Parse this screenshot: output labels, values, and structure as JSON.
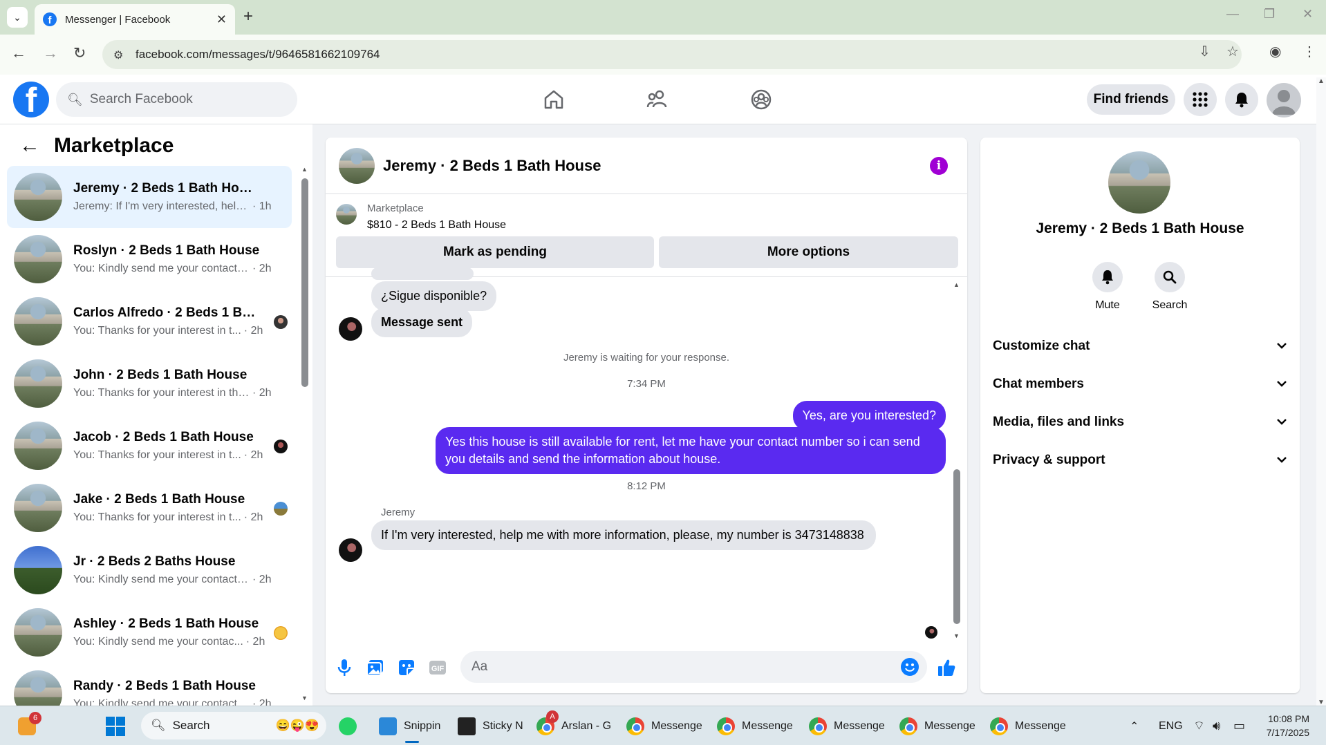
{
  "browser": {
    "tab_title": "Messenger | Facebook",
    "url": "facebook.com/messages/t/9646581662109764"
  },
  "fb": {
    "search_placeholder": "Search Facebook",
    "find_friends": "Find friends"
  },
  "sidebar": {
    "title": "Marketplace",
    "conversations": [
      {
        "name": "Jeremy · 2 Beds 1 Bath House",
        "preview": "Jeremy: If I'm very interested, help ...",
        "time": "· 1h",
        "active": true
      },
      {
        "name": "Roslyn · 2 Beds 1 Bath House",
        "preview": "You: Kindly send me your contact n...",
        "time": "· 2h"
      },
      {
        "name": "Carlos Alfredo · 2 Beds 1 Bath ...",
        "preview": "You: Thanks for your interest in t...",
        "time": "· 2h"
      },
      {
        "name": "John · 2 Beds 1 Bath House",
        "preview": "You: Thanks for your interest in the ...",
        "time": "· 2h"
      },
      {
        "name": "Jacob · 2 Beds 1 Bath House",
        "preview": "You: Thanks for your interest in t...",
        "time": "· 2h"
      },
      {
        "name": "Jake · 2 Beds 1 Bath House",
        "preview": "You: Thanks for your interest in t...",
        "time": "· 2h"
      },
      {
        "name": "Jr · 2 Beds 2 Baths House",
        "preview": "You: Kindly send me your contact n...",
        "time": "· 2h"
      },
      {
        "name": "Ashley · 2 Beds 1 Bath House",
        "preview": "You: Kindly send me your contac...",
        "time": "· 2h"
      },
      {
        "name": "Randy · 2 Beds 1 Bath House",
        "preview": "You: Kindly send me your contact n...",
        "time": "· 2h"
      }
    ]
  },
  "chat": {
    "title": "Jeremy · 2 Beds 1 Bath House",
    "marketplace_label": "Marketplace",
    "listing": "$810 - 2 Beds 1 Bath House",
    "mark_pending": "Mark as pending",
    "more_options": "More options",
    "messages": {
      "m1": "¿Sigue disponible?",
      "m2": "Message sent",
      "waiting": "Jeremy is waiting for your response.",
      "time1": "7:34 PM",
      "m3": "Yes, are you interested?",
      "m4": "Yes this house is still available for rent, let me have your contact number so i can send you details and send the information about house.",
      "time2": "8:12 PM",
      "sender": "Jeremy",
      "m5": "If I'm very interested, help me with more information, please, my number is 3473148838"
    },
    "composer_placeholder": "Aa"
  },
  "details": {
    "name": "Jeremy · 2 Beds 1 Bath House",
    "mute": "Mute",
    "search": "Search",
    "sections": [
      "Customize chat",
      "Chat members",
      "Media, files and links",
      "Privacy & support"
    ]
  },
  "taskbar": {
    "search": "Search",
    "apps": [
      "Snippin",
      "Sticky N",
      "Arslan - G",
      "Messenge",
      "Messenge",
      "Messenge",
      "Messenge",
      "Messenge"
    ],
    "notification_count": "6",
    "arslan_badge": "A",
    "lang": "ENG",
    "time": "10:08 PM",
    "date": "7/17/2025"
  },
  "colors": {
    "fb_blue": "#1877f2",
    "outgoing_bubble": "#5a2af0",
    "info_purple": "#a000d4"
  }
}
